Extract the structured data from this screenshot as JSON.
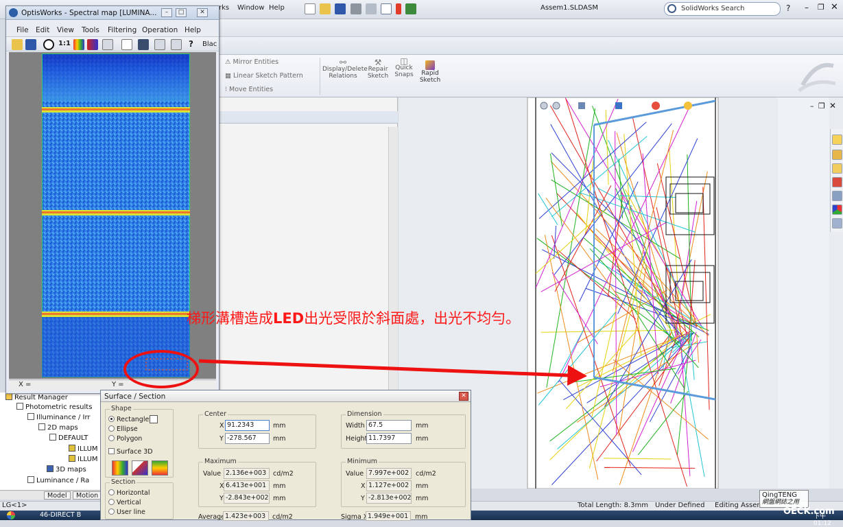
{
  "solidworks": {
    "menus": [
      "rks",
      "Window",
      "Help"
    ],
    "doc_title": "Assem1.SLDASM",
    "search_label": "SolidWorks Search",
    "help_glyph": "?",
    "ribbon": {
      "mirror_entities": "Mirror Entities",
      "linear_sketch_pattern": "Linear Sketch Pattern",
      "move_entities": "Move Entities",
      "display_delete_relations": "Display/Delete Relations",
      "repair_sketch": "Repair Sketch",
      "quick_snaps": "Quick Snaps",
      "rapid_sketch": "Rapid Sketch"
    },
    "status": {
      "left": "LG<1>",
      "total_length": "Total Length: 8.3mm",
      "state": "Under Defined",
      "editing": "Editing Assen"
    },
    "taskbar_item": "46-DIRECT B",
    "clock": "下午 01:12",
    "tree": {
      "result_manager": "Result Manager",
      "photometric_results": "Photometric results",
      "illuminance": "Illuminance / Irr",
      "maps_2d": "2D maps",
      "default": "DEFAULT",
      "illum1": "ILLUM",
      "illum2": "ILLUM",
      "maps_3d": "3D maps",
      "luminance": "Luminance / Ra"
    },
    "bottom_tabs": [
      "Model",
      "Motion"
    ],
    "colors": {
      "accent_blue": "#3f6fb5",
      "status_bg": "#e4e7ec"
    }
  },
  "optis": {
    "title": "OptisWorks - Spectral map [LUMINA...",
    "menu": [
      "File",
      "Edit",
      "View",
      "Tools",
      "Filtering",
      "Operation",
      "Help"
    ],
    "toolbar_text": {
      "one_to_one": "1:1",
      "black": "Blac"
    },
    "status": {
      "x": "X =",
      "y": "Y ="
    }
  },
  "dialog": {
    "title": "Surface / Section",
    "shape": {
      "label": "Shape",
      "options": [
        "Rectangle",
        "Ellipse",
        "Polygon"
      ],
      "selected": "Rectangle",
      "surface3d": "Surface 3D"
    },
    "section": {
      "label": "Section",
      "options": [
        "Horizontal",
        "Vertical",
        "User line"
      ]
    },
    "center": {
      "label": "Center",
      "x_label": "X",
      "x": "91.2343",
      "y_label": "Y",
      "y": "-278.567",
      "unit": "mm"
    },
    "dimension": {
      "label": "Dimension",
      "width_label": "Width",
      "width": "67.5",
      "height_label": "Height",
      "height": "11.7397",
      "unit": "mm"
    },
    "maximum": {
      "label": "Maximum",
      "value_label": "Value",
      "value": "2.136e+003",
      "value_unit": "cd/m2",
      "x_label": "X",
      "x": "6.413e+001",
      "y_label": "Y",
      "y": "-2.843e+002",
      "unit": "mm"
    },
    "minimum": {
      "label": "Minimum",
      "value_label": "Value",
      "value": "7.997e+002",
      "value_unit": "cd/m2",
      "x_label": "X",
      "x": "1.127e+002",
      "y_label": "Y",
      "y": "-2.813e+002",
      "unit": "mm"
    },
    "average": {
      "label": "Average",
      "value": "1.423e+003",
      "unit": "cd/m2"
    },
    "sigma": {
      "label": "Sigma X",
      "value": "1.949e+001",
      "unit": "mm"
    }
  },
  "annotation": {
    "part1": "梯形溝槽造成",
    "bold": "LED",
    "part2": "出光受限於斜面處，出光不均勻。",
    "color": "#ff1818"
  },
  "watermark": {
    "line1": "QingTENG",
    "line2": "網盤網誌之用",
    "site": "OECK.com"
  }
}
